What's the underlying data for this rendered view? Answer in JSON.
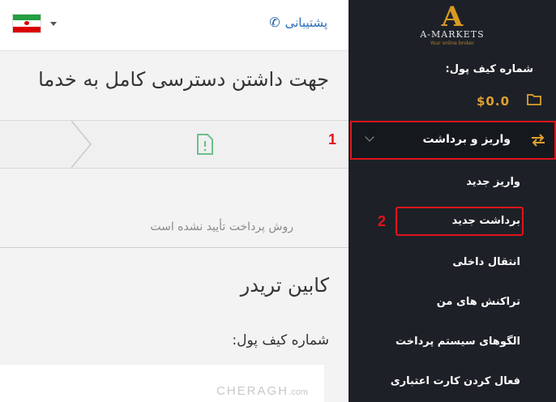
{
  "header": {
    "support_label": "پشتیبانی",
    "language_flag": "iran-flag"
  },
  "main": {
    "headline": "جهت داشتن دسترسی کامل به خدما",
    "method_note": "روش پرداخت تأیید نشده است",
    "cabin_title": "کابین تریدر",
    "wallet_label": "شماره کیف پول:"
  },
  "sidebar": {
    "logo_text": "A-MARKETS",
    "logo_tagline": "Your online broker",
    "wallet_label": "شماره کیف پول:",
    "balance": "$0.0",
    "deposit_withdraw": "واریز و برداشت",
    "submenu": {
      "new_deposit": "واریز جدید",
      "new_withdrawal": "برداشت جدید",
      "internal_transfer": "انتقال داخلی",
      "my_transactions": "تراکنش های من",
      "payment_patterns": "الگوهای سیستم پرداخت",
      "activate_card": "فعال کردن کارت اعتباری"
    }
  },
  "annotations": {
    "one": "1",
    "two": "2"
  },
  "watermark": {
    "main": "CHERAGH",
    "suffix": ".com"
  },
  "colors": {
    "sidebar_bg": "#1d2127",
    "accent": "#e0a030",
    "highlight": "#e0141c",
    "link": "#2a6db5"
  }
}
